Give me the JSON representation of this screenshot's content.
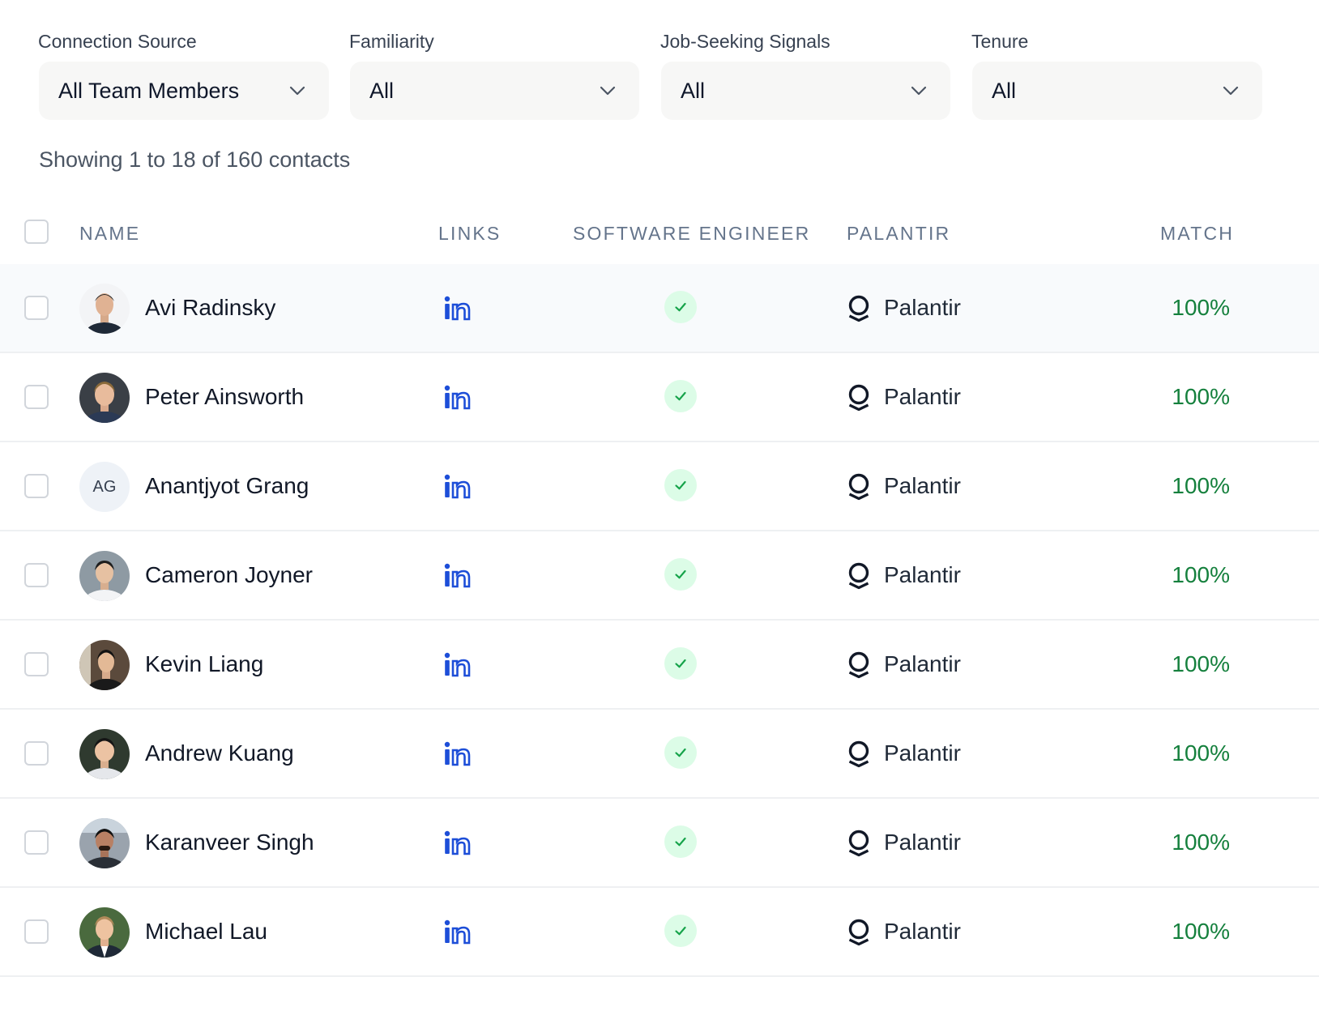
{
  "filters": [
    {
      "label": "Connection Source",
      "value": "All Team Members"
    },
    {
      "label": "Familiarity",
      "value": "All"
    },
    {
      "label": "Job-Seeking Signals",
      "value": "All"
    },
    {
      "label": "Tenure",
      "value": "All"
    }
  ],
  "summary": "Showing 1 to 18 of 160 contacts",
  "table": {
    "headers": {
      "name": "NAME",
      "links": "LINKS",
      "role": "SOFTWARE ENGINEER",
      "company": "PALANTIR",
      "match": "MATCH"
    },
    "rows": [
      {
        "name": "Avi Radinsky",
        "avatar": "photo",
        "company": "Palantir",
        "match": "100%"
      },
      {
        "name": "Peter Ainsworth",
        "avatar": "photo",
        "company": "Palantir",
        "match": "100%"
      },
      {
        "name": "Anantjyot Grang",
        "avatar": "initials",
        "initials": "AG",
        "company": "Palantir",
        "match": "100%"
      },
      {
        "name": "Cameron Joyner",
        "avatar": "photo",
        "company": "Palantir",
        "match": "100%"
      },
      {
        "name": "Kevin Liang",
        "avatar": "photo",
        "company": "Palantir",
        "match": "100%"
      },
      {
        "name": "Andrew Kuang",
        "avatar": "photo",
        "company": "Palantir",
        "match": "100%"
      },
      {
        "name": "Karanveer Singh",
        "avatar": "photo",
        "company": "Palantir",
        "match": "100%"
      },
      {
        "name": "Michael Lau",
        "avatar": "photo",
        "company": "Palantir",
        "match": "100%"
      }
    ]
  },
  "icons": {
    "dropdown": "chevron-down-icon",
    "link": "linkedin-icon",
    "role_match": "check-icon",
    "company": "palantir-logo-icon"
  },
  "colors": {
    "linkedin": "#1d4ed8",
    "match": "#15803d",
    "check_bg": "#dcfce7",
    "check": "#16a34a"
  }
}
